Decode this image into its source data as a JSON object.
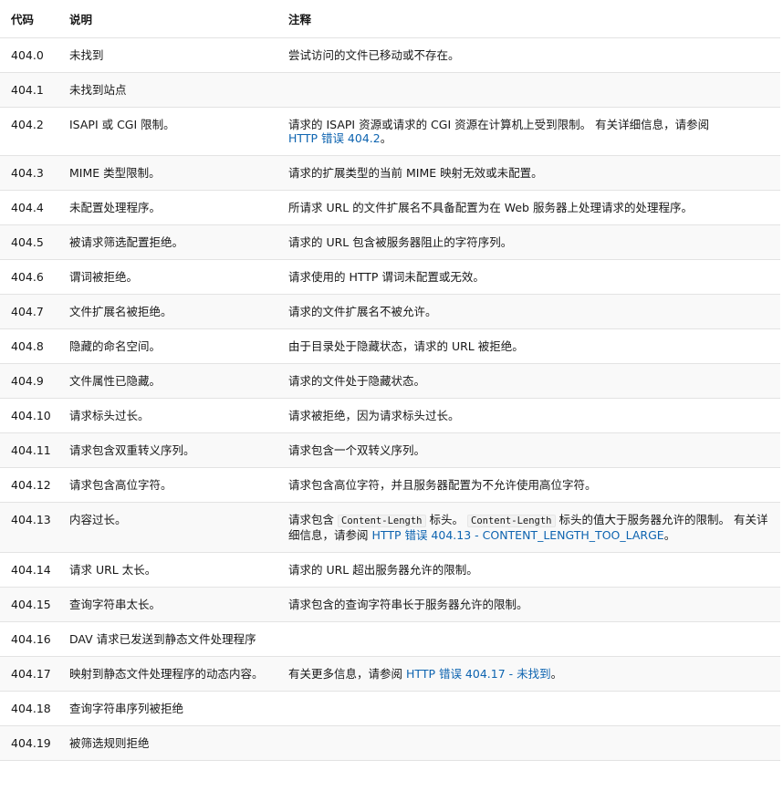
{
  "header": {
    "code": "代码",
    "description": "说明",
    "notes": "注释"
  },
  "rows": [
    {
      "code": "404.0",
      "description": "未找到",
      "notes": "尝试访问的文件已移动或不存在。"
    },
    {
      "code": "404.1",
      "description": "未找到站点",
      "notes": ""
    },
    {
      "code": "404.2",
      "description": "ISAPI 或 CGI 限制。",
      "notes": "请求的 ISAPI 资源或请求的 CGI 资源在计算机上受到限制。 有关详细信息，请参阅",
      "link": "HTTP 错误 404.2",
      "notes_end": "。"
    },
    {
      "code": "404.3",
      "description": "MIME 类型限制。",
      "notes": "请求的扩展类型的当前 MIME 映射无效或未配置。"
    },
    {
      "code": "404.4",
      "description": "未配置处理程序。",
      "notes": "所请求 URL 的文件扩展名不具备配置为在 Web 服务器上处理请求的处理程序。"
    },
    {
      "code": "404.5",
      "description": "被请求筛选配置拒绝。",
      "notes": "请求的 URL 包含被服务器阻止的字符序列。"
    },
    {
      "code": "404.6",
      "description": "谓词被拒绝。",
      "notes": "请求使用的 HTTP 谓词未配置或无效。"
    },
    {
      "code": "404.7",
      "description": "文件扩展名被拒绝。",
      "notes": "请求的文件扩展名不被允许。"
    },
    {
      "code": "404.8",
      "description": "隐藏的命名空间。",
      "notes": "由于目录处于隐藏状态，请求的 URL 被拒绝。"
    },
    {
      "code": "404.9",
      "description": "文件属性已隐藏。",
      "notes": "请求的文件处于隐藏状态。"
    },
    {
      "code": "404.10",
      "description": "请求标头过长。",
      "notes": "请求被拒绝，因为请求标头过长。"
    },
    {
      "code": "404.11",
      "description": "请求包含双重转义序列。",
      "notes": "请求包含一个双转义序列。"
    },
    {
      "code": "404.12",
      "description": "请求包含高位字符。",
      "notes": "请求包含高位字符，并且服务器配置为不允许使用高位字符。"
    },
    {
      "code": "404.13",
      "description": "内容过长。",
      "notes_a": "请求包含",
      "code1": "Content-Length",
      "notes_b": "标头。",
      "code2": "Content-Length",
      "notes_c": "标头的值大于服务器允许的限制。 有关详细信息，请参阅",
      "link": "HTTP 错误 404.13 - CONTENT_LENGTH_TOO_LARGE",
      "notes_end": "。"
    },
    {
      "code": "404.14",
      "description": "请求 URL 太长。",
      "notes": "请求的 URL 超出服务器允许的限制。"
    },
    {
      "code": "404.15",
      "description": "查询字符串太长。",
      "notes": "请求包含的查询字符串长于服务器允许的限制。"
    },
    {
      "code": "404.16",
      "description": "DAV 请求已发送到静态文件处理程序",
      "notes": ""
    },
    {
      "code": "404.17",
      "description": "映射到静态文件处理程序的动态内容。",
      "notes": "有关更多信息，请参阅",
      "link": "HTTP 错误 404.17 - 未找到",
      "notes_end": "。"
    },
    {
      "code": "404.18",
      "description": "查询字符串序列被拒绝",
      "notes": ""
    },
    {
      "code": "404.19",
      "description": "被筛选规则拒绝",
      "notes": ""
    }
  ],
  "colors": {
    "link": "#0e64b0",
    "row_alt": "#f9f9f9",
    "border": "#e3e3e3"
  }
}
